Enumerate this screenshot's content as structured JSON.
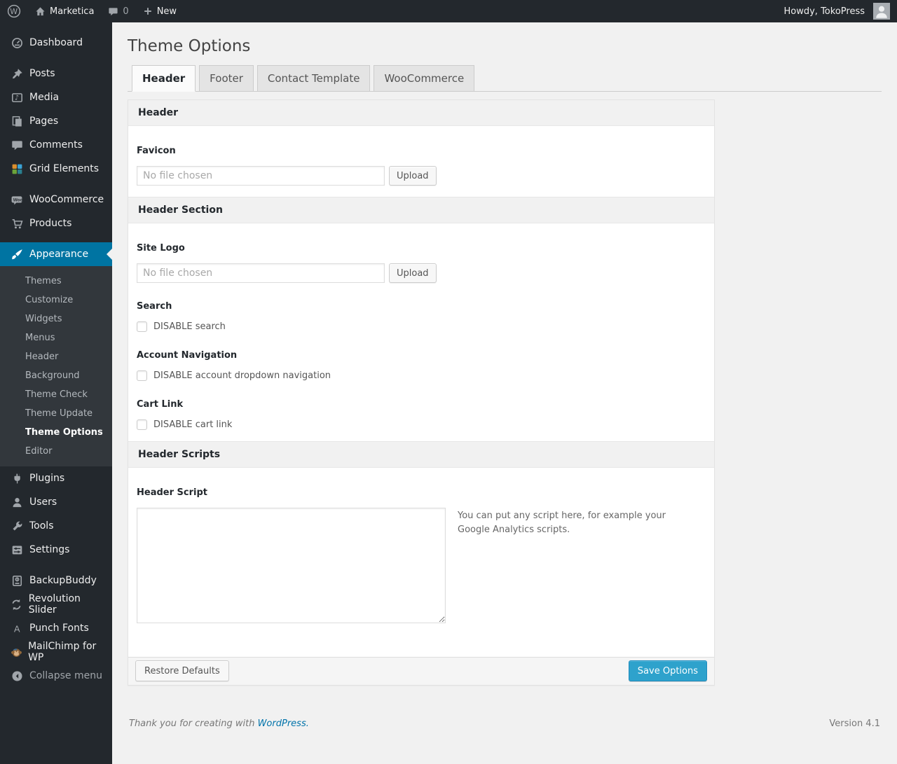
{
  "admin_bar": {
    "site_name": "Marketica",
    "comments_count": "0",
    "new_label": "New",
    "howdy_text": "Howdy, TokoPress"
  },
  "sidebar": {
    "items": [
      {
        "label": "Dashboard",
        "icon": "dashboard-icon"
      },
      {
        "label": "Posts",
        "icon": "posts-icon"
      },
      {
        "label": "Media",
        "icon": "media-icon"
      },
      {
        "label": "Pages",
        "icon": "pages-icon"
      },
      {
        "label": "Comments",
        "icon": "comments-icon"
      },
      {
        "label": "Grid Elements",
        "icon": "grid-elements-icon"
      },
      {
        "label": "WooCommerce",
        "icon": "woocommerce-icon"
      },
      {
        "label": "Products",
        "icon": "products-icon"
      },
      {
        "label": "Appearance",
        "icon": "appearance-icon",
        "active": true
      }
    ],
    "appearance_submenu": [
      "Themes",
      "Customize",
      "Widgets",
      "Menus",
      "Header",
      "Background",
      "Theme Check",
      "Theme Update",
      "Theme Options",
      "Editor"
    ],
    "current_submenu_item": "Theme Options",
    "items_lower": [
      {
        "label": "Plugins",
        "icon": "plugins-icon"
      },
      {
        "label": "Users",
        "icon": "users-icon"
      },
      {
        "label": "Tools",
        "icon": "tools-icon"
      },
      {
        "label": "Settings",
        "icon": "settings-icon"
      },
      {
        "label": "BackupBuddy",
        "icon": "backupbuddy-icon"
      },
      {
        "label": "Revolution Slider",
        "icon": "revolution-slider-icon"
      },
      {
        "label": "Punch Fonts",
        "icon": "punch-fonts-icon"
      },
      {
        "label": "MailChimp for WP",
        "icon": "mailchimp-icon"
      }
    ],
    "collapse_label": "Collapse menu"
  },
  "main": {
    "page_title": "Theme Options",
    "tabs": [
      {
        "label": "Header",
        "active": true
      },
      {
        "label": "Footer",
        "active": false
      },
      {
        "label": "Contact Template",
        "active": false
      },
      {
        "label": "WooCommerce",
        "active": false
      }
    ],
    "sections": {
      "header": {
        "title": "Header",
        "favicon": {
          "label": "Favicon",
          "file_value": "No file chosen",
          "upload_label": "Upload"
        }
      },
      "header_section": {
        "title": "Header Section",
        "site_logo": {
          "label": "Site Logo",
          "file_value": "No file chosen",
          "upload_label": "Upload"
        },
        "search": {
          "label": "Search",
          "checkbox_label": "DISABLE search",
          "checked": false
        },
        "account_navigation": {
          "label": "Account Navigation",
          "checkbox_label": "DISABLE account dropdown navigation",
          "checked": false
        },
        "cart_link": {
          "label": "Cart Link",
          "checkbox_label": "DISABLE cart link",
          "checked": false
        }
      },
      "header_scripts": {
        "title": "Header Scripts",
        "header_script": {
          "label": "Header Script",
          "value": "",
          "help": "You can put any script here, for example your Google Analytics scripts."
        }
      }
    },
    "actions": {
      "restore_label": "Restore Defaults",
      "save_label": "Save Options"
    }
  },
  "page_footer": {
    "thanks_prefix": "Thank you for creating with ",
    "thanks_link": "WordPress.",
    "version": "Version 4.1"
  },
  "colors": {
    "admin_bar_bg": "#23282d",
    "menu_highlight": "#0074a2",
    "primary_button_bg": "#2ea2cc",
    "primary_button_border": "#1e8cbe",
    "link": "#0073aa",
    "page_bg": "#f1f1f1"
  }
}
